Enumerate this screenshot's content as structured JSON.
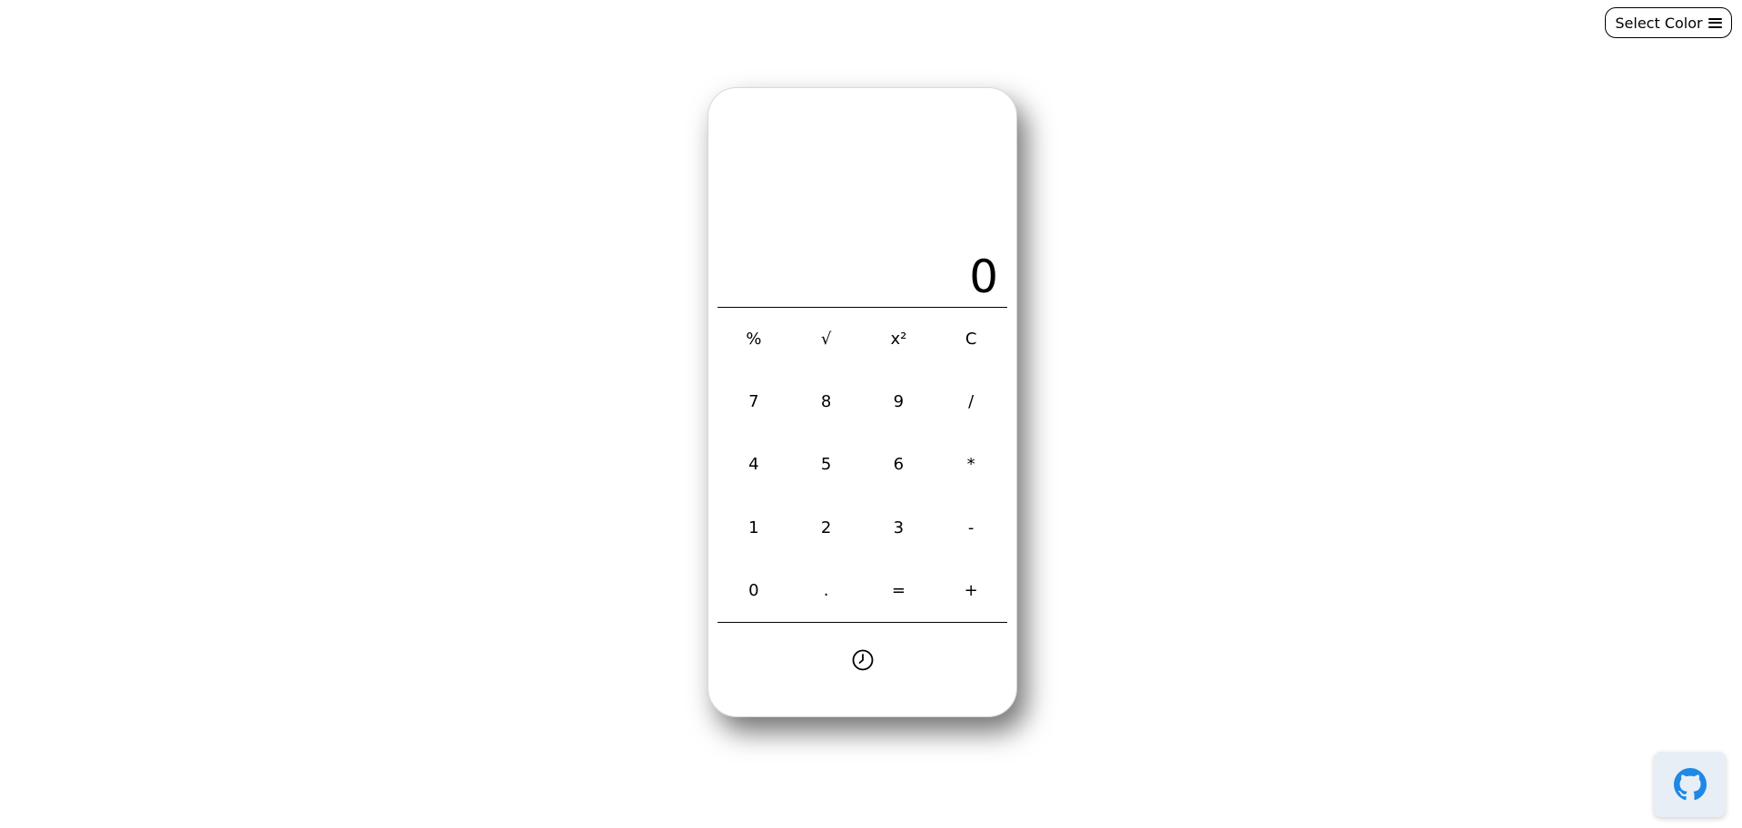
{
  "header": {
    "select_color_label": "Select Color",
    "menu_icon": "hamburger-icon"
  },
  "calculator": {
    "display_value": "0",
    "keys": [
      [
        "%",
        "√",
        "x²",
        "C"
      ],
      [
        "7",
        "8",
        "9",
        "/"
      ],
      [
        "4",
        "5",
        "6",
        "*"
      ],
      [
        "1",
        "2",
        "3",
        "-"
      ],
      [
        "0",
        ".",
        "=",
        "+"
      ]
    ],
    "history_icon": "clock-icon"
  },
  "footer": {
    "github_icon": "github-icon"
  },
  "colors": {
    "background": "#ffffff",
    "text": "#000000",
    "github_button_bg": "#e7eef5",
    "github_icon": "#1e88e5"
  }
}
